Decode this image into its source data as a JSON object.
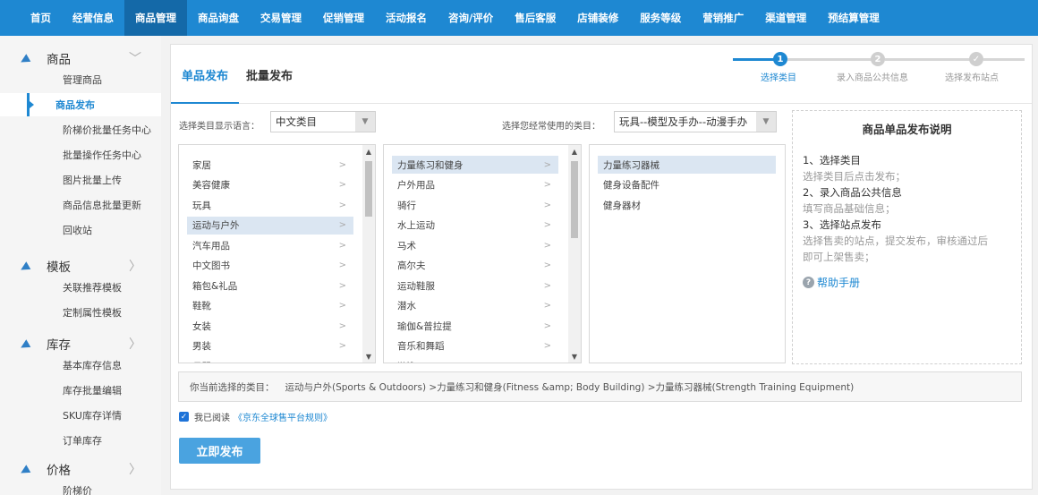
{
  "topnav": {
    "items": [
      {
        "label": "首页"
      },
      {
        "label": "经营信息"
      },
      {
        "label": "商品管理",
        "active": true
      },
      {
        "label": "商品询盘"
      },
      {
        "label": "交易管理"
      },
      {
        "label": "促销管理"
      },
      {
        "label": "活动报名"
      },
      {
        "label": "咨询/评价"
      },
      {
        "label": "售后客服"
      },
      {
        "label": "店铺装修"
      },
      {
        "label": "服务等级"
      },
      {
        "label": "营销推广"
      },
      {
        "label": "渠道管理"
      },
      {
        "label": "预结算管理"
      }
    ]
  },
  "sidebar": {
    "groups": [
      {
        "title": "商品",
        "icon": "send-icon",
        "expanded": true,
        "items": [
          "管理商品",
          "商品发布",
          "阶梯价批量任务中心",
          "批量操作任务中心",
          "图片批量上传",
          "商品信息批量更新",
          "回收站"
        ]
      },
      {
        "title": "模板",
        "icon": "send-icon",
        "expanded": false,
        "items": [
          "关联推荐模板",
          "定制属性模板"
        ]
      },
      {
        "title": "库存",
        "icon": "send-icon",
        "expanded": false,
        "items": [
          "基本库存信息",
          "库存批量编辑",
          "SKU库存详情",
          "订单库存"
        ]
      },
      {
        "title": "价格",
        "icon": "send-icon",
        "expanded": false,
        "items": [
          "阶梯价"
        ]
      }
    ],
    "active_item": "商品发布"
  },
  "tabs": {
    "single": "单品发布",
    "batch": "批量发布"
  },
  "steps": [
    {
      "num": "1",
      "label": "选择类目",
      "state": "current"
    },
    {
      "num": "2",
      "label": "录入商品公共信息",
      "state": "todo"
    },
    {
      "num": "✓",
      "label": "选择发布站点",
      "state": "todo"
    }
  ],
  "language": {
    "label": "选择类目显示语言：",
    "value": "中文类目"
  },
  "common_category": {
    "label": "选择您经常使用的类目：",
    "value": "玩具--模型及手办--动漫手办"
  },
  "categories": {
    "level1": [
      "家居",
      "美容健康",
      "玩具",
      "运动与户外",
      "汽车用品",
      "中文图书",
      "箱包&礼品",
      "鞋靴",
      "女装",
      "男装",
      "母婴"
    ],
    "level1_selected": 3,
    "level2": [
      "力量练习和健身",
      "户外用品",
      "骑行",
      "水上运动",
      "马术",
      "高尔夫",
      "运动鞋服",
      "潜水",
      "瑜伽&普拉提",
      "音乐和舞蹈",
      "游泳"
    ],
    "level2_selected": 0,
    "level3": [
      "力量练习器械",
      "健身设备配件",
      "健身器材"
    ],
    "level3_selected": 0
  },
  "info": {
    "title": "商品单品发布说明",
    "steps": [
      {
        "head": "1、选择类目",
        "desc": [
          "选择类目后点击发布；"
        ]
      },
      {
        "head": "2、录入商品公共信息",
        "desc": [
          "填写商品基础信息；"
        ]
      },
      {
        "head": "3、选择站点发布",
        "desc": [
          "选择售卖的站点，提交发布，审核通过后",
          "即可上架售卖；"
        ]
      }
    ],
    "help": "帮助手册"
  },
  "path": {
    "label": "你当前选择的类目：",
    "value": "运动与户外(Sports & Outdoors) >力量练习和健身(Fitness &amp; Body Building) >力量练习器械(Strength Training Equipment)"
  },
  "agree": {
    "checked": true,
    "text": "我已阅读",
    "link": "《京东全球售平台规则》"
  },
  "publish_button": "立即发布",
  "colors": {
    "primary": "#1e88d2",
    "nav_active": "#1469a8",
    "button": "#4aa3e0",
    "selected_bg": "#dbe6f2"
  }
}
